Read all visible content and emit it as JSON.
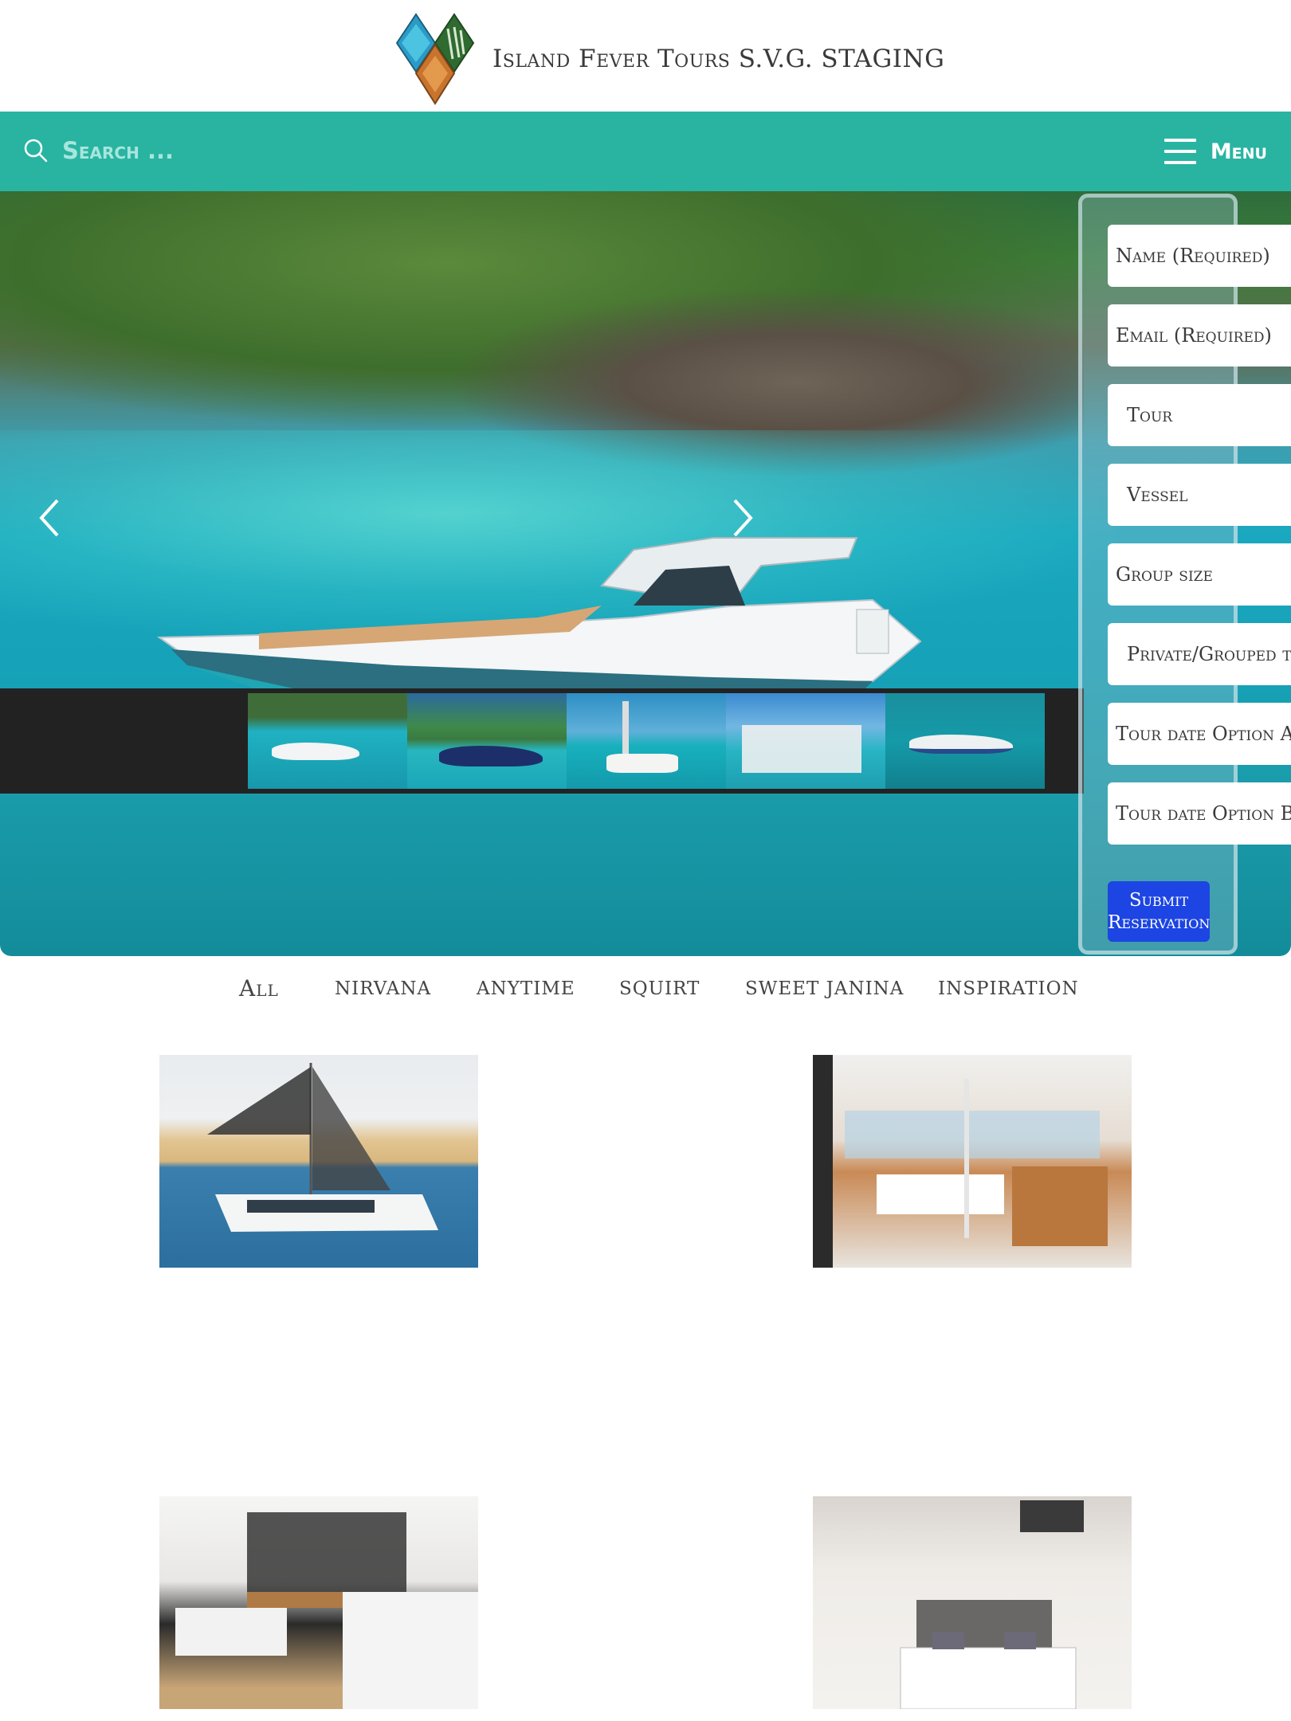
{
  "header": {
    "site_title": "Island Fever Tours S.V.G. STAGING"
  },
  "nav": {
    "search_placeholder": "Search ...",
    "menu_label": "Menu"
  },
  "booking_form": {
    "fields": [
      "Name (Required)",
      "Email (Required)",
      "Tour",
      "Vessel",
      "Group size",
      "Private/Grouped t",
      "Tour date Option A",
      "Tour date Option B"
    ],
    "submit_label": "Submit Reservation"
  },
  "filters": [
    "All",
    "NIRVANA",
    "ANYTIME",
    "SQUIRT",
    "SWEET JANINA",
    "INSPIRATION"
  ],
  "colors": {
    "nav_bg": "#29b4a2",
    "submit_bg": "#1c45e3",
    "thumb_strip_bg": "#222222"
  }
}
